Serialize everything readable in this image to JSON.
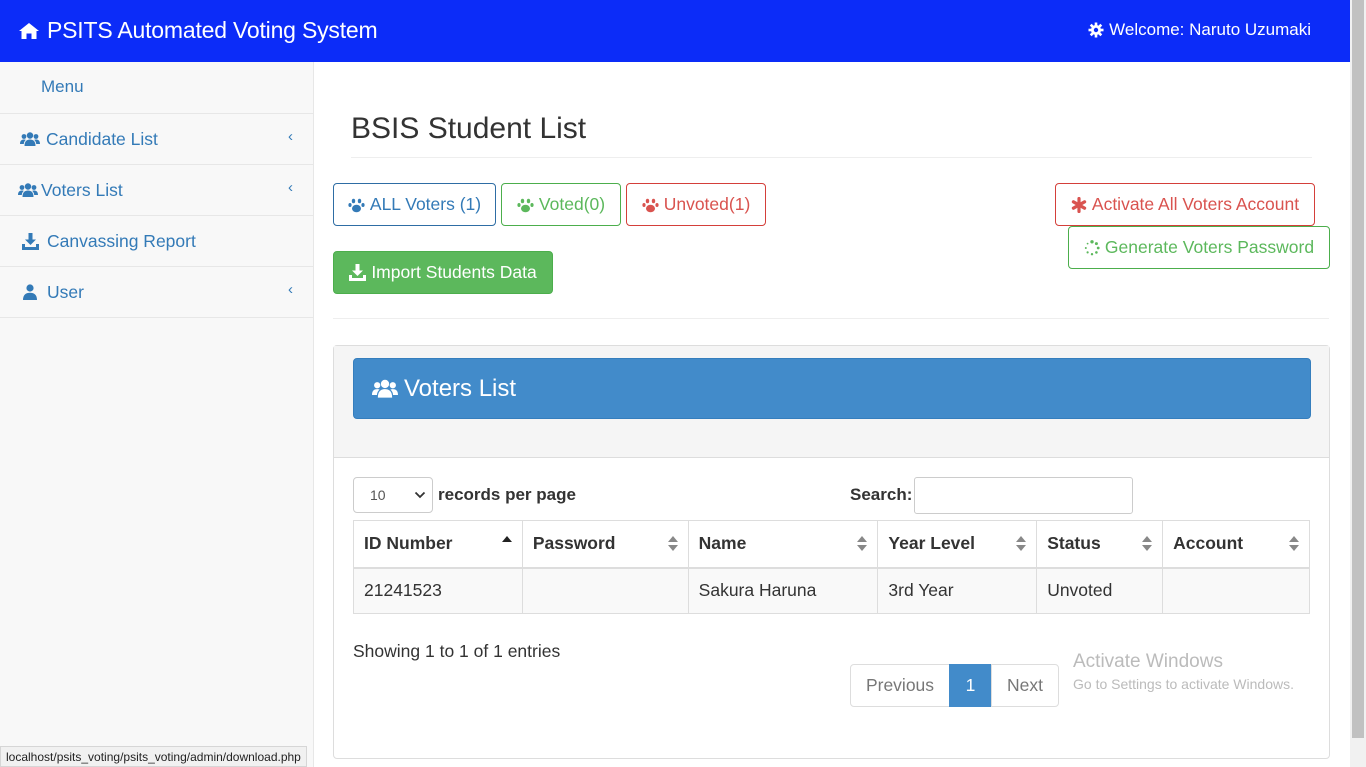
{
  "topbar": {
    "brand_icon": "home-icon",
    "brand": "PSITS Automated Voting System",
    "welcome_icon": "gear-icon",
    "welcome": "Welcome: Naruto Uzumaki",
    "bg_color": "#0c2cf8"
  },
  "sidebar": {
    "menu_header": "Menu",
    "items": [
      {
        "label": "Candidate List",
        "icon": "users-icon",
        "has_chevron": true
      },
      {
        "label": "Voters List",
        "icon": "users-icon",
        "has_chevron": true
      },
      {
        "label": "Canvassing Report",
        "icon": "download-icon",
        "has_chevron": false
      },
      {
        "label": "User",
        "icon": "user-icon",
        "has_chevron": true
      }
    ]
  },
  "main": {
    "title": "BSIS Student List",
    "buttons": {
      "all_voters": "ALL Voters (1)",
      "voted": "Voted(0)",
      "unvoted": "Unvoted(1)",
      "activate_all": "Activate All Voters Account",
      "generate_password": "Generate Voters Password",
      "import": "Import Students Data"
    },
    "panel_title": "Voters List",
    "length": {
      "selected": "10",
      "label": "records per page"
    },
    "search_label": "Search:",
    "search_value": "",
    "table": {
      "columns": [
        "ID Number",
        "Password",
        "Name",
        "Year Level",
        "Status",
        "Account"
      ],
      "sorted_column": "ID Number",
      "rows": [
        [
          "21241523",
          "",
          "Sakura Haruna",
          "3rd Year",
          "Unvoted",
          ""
        ]
      ]
    },
    "info": "Showing 1 to 1 of 1 entries",
    "pagination": {
      "previous": "Previous",
      "current": "1",
      "next": "Next"
    }
  },
  "watermark": {
    "line1": "Activate Windows",
    "line2": "Go to Settings to activate Windows."
  },
  "statusbar": "localhost/psits_voting/psits_voting/admin/download.php",
  "colors": {
    "primary": "#337ab7",
    "success": "#5cb85c",
    "danger": "#d9534f",
    "panel_header": "#428bca"
  }
}
